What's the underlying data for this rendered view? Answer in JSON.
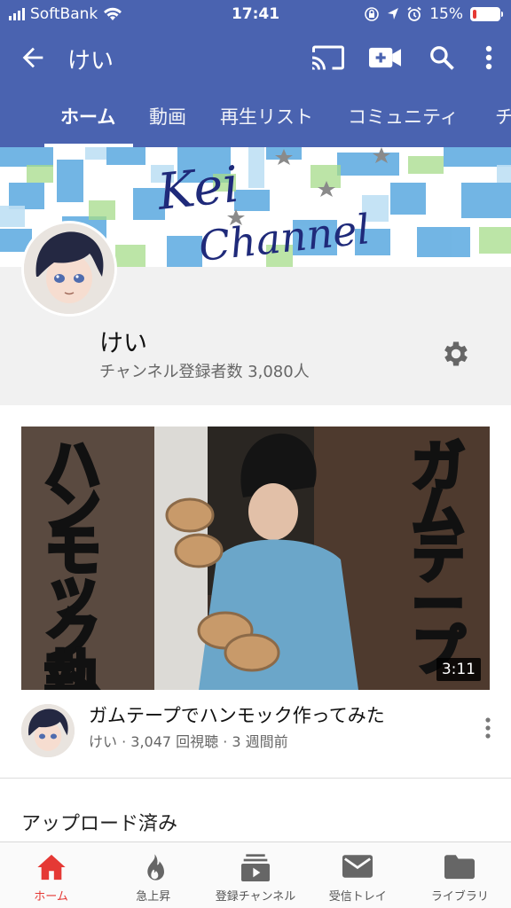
{
  "status_bar": {
    "carrier": "SoftBank",
    "time": "17:41",
    "battery": "15%",
    "battery_level": 0.15,
    "battery_color": "#e53935"
  },
  "app_bar": {
    "title": "けい",
    "icons": [
      "back-arrow-icon",
      "cast-icon",
      "video-add-icon",
      "search-icon",
      "more-vert-icon"
    ]
  },
  "tabs": [
    {
      "label": "ホーム",
      "active": true
    },
    {
      "label": "動画"
    },
    {
      "label": "再生リスト"
    },
    {
      "label": "コミュニティ"
    },
    {
      "label": "チ"
    }
  ],
  "banner": {
    "line1": "Kei",
    "line2": "Channel"
  },
  "channel": {
    "name": "けい",
    "subscribers": "チャンネル登録者数 3,080人"
  },
  "video": {
    "thumb_left_text": "ハンモック執",
    "thumb_right_text": "ガムテープ",
    "duration": "3:11",
    "title": "ガムテープでハンモック作ってみた",
    "meta": "けい · 3,047 回視聴 · 3 週間前"
  },
  "section_title": "アップロード済み",
  "bottom_nav": [
    {
      "label": "ホーム",
      "icon": "home-icon",
      "active": true
    },
    {
      "label": "急上昇",
      "icon": "trending-flame-icon"
    },
    {
      "label": "登録チャンネル",
      "icon": "subscriptions-icon"
    },
    {
      "label": "受信トレイ",
      "icon": "inbox-mail-icon"
    },
    {
      "label": "ライブラリ",
      "icon": "library-folder-icon"
    }
  ],
  "colors": {
    "header": "#4a63b0",
    "accent": "#e53935",
    "tab_indicator": "#ffffff"
  }
}
